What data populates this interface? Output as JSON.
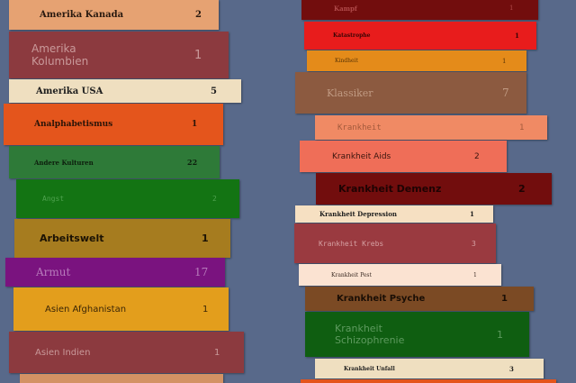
{
  "colors": {
    "background": "#58698a"
  },
  "left_column": [
    {
      "label": "Amerika Kanada",
      "count": "2",
      "color": "#e6a272"
    },
    {
      "label": "Amerika\nKolumbien",
      "count": "1",
      "color": "#8c3a3f"
    },
    {
      "label": "Amerika USA",
      "count": "5",
      "color": "#efdfc0"
    },
    {
      "label": "Analphabetismus",
      "count": "1",
      "color": "#e4551c"
    },
    {
      "label": "Andere Kulturen",
      "count": "22",
      "color": "#2e7a38"
    },
    {
      "label": "Angst",
      "count": "2",
      "color": "#137413"
    },
    {
      "label": "Arbeitswelt",
      "count": "1",
      "color": "#a67c1f"
    },
    {
      "label": "Armut",
      "count": "17",
      "color": "#7a137f"
    },
    {
      "label": "Asien Afghanistan",
      "count": "1",
      "color": "#e39e1c"
    },
    {
      "label": "Asien Indien",
      "count": "1",
      "color": "#8c3a3f"
    }
  ],
  "right_column": [
    {
      "label": "Kampf",
      "count": "1",
      "color": "#720d0d"
    },
    {
      "label": "Katastrophe",
      "count": "1",
      "color": "#e81c1c"
    },
    {
      "label": "Kindheit",
      "count": "1",
      "color": "#e48b1a"
    },
    {
      "label": "Klassiker",
      "count": "7",
      "color": "#8c5a40"
    },
    {
      "label": "Krankheit",
      "count": "1",
      "color": "#f08a64"
    },
    {
      "label": "Krankheit Aids",
      "count": "2",
      "color": "#ef6e58"
    },
    {
      "label": "Krankheit Demenz",
      "count": "2",
      "color": "#720d0d"
    },
    {
      "label": "Krankheit Depression",
      "count": "1",
      "color": "#f6e0c2"
    },
    {
      "label": "Krankheit Krebs",
      "count": "3",
      "color": "#9a3a40"
    },
    {
      "label": "Krankheit Pest",
      "count": "1",
      "color": "#fbe3d2"
    },
    {
      "label": "Krankheit Psyche",
      "count": "1",
      "color": "#7b4a24"
    },
    {
      "label": "Krankheit\nSchizophrenie",
      "count": "1",
      "color": "#0f5e11"
    },
    {
      "label": "Krankheit Unfall",
      "count": "3",
      "color": "#efdfc0"
    }
  ]
}
